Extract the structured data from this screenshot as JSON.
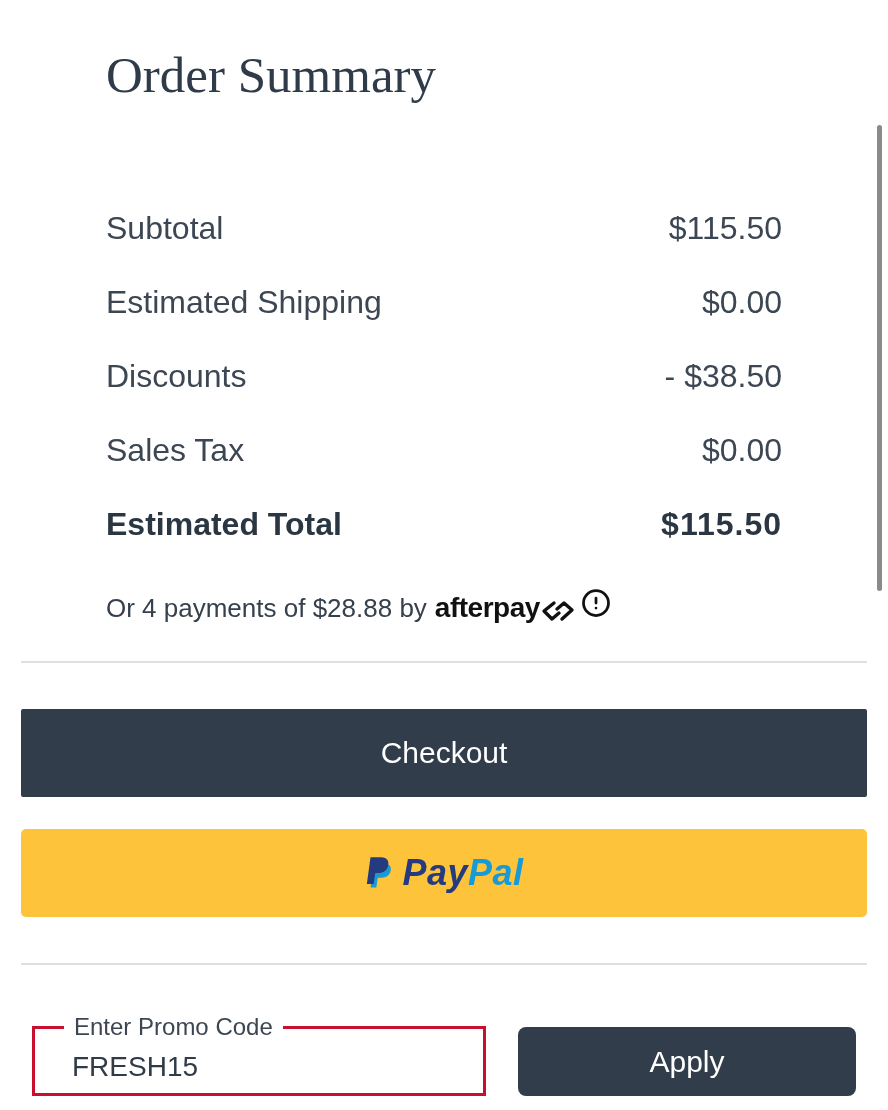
{
  "title": "Order Summary",
  "summary_rows": [
    {
      "label": "Subtotal",
      "value": "$115.50",
      "kind": "line"
    },
    {
      "label": "Estimated Shipping",
      "value": "$0.00",
      "kind": "line"
    },
    {
      "label": "Discounts",
      "value": "- $38.50",
      "kind": "line"
    },
    {
      "label": "Sales Tax",
      "value": "$0.00",
      "kind": "line"
    },
    {
      "label": "Estimated Total",
      "value": "$115.50",
      "kind": "total"
    }
  ],
  "installments": {
    "text": "Or 4 payments of $28.88 by",
    "brand": "afterpay"
  },
  "checkout_button": {
    "label": "Checkout"
  },
  "paypal_button": {
    "label_parts": [
      "Pay",
      "Pal"
    ]
  },
  "promo_code": {
    "label": "Enter Promo Code",
    "value": "FRESH15",
    "focused": true
  },
  "apply_button": {
    "label": "Apply"
  }
}
